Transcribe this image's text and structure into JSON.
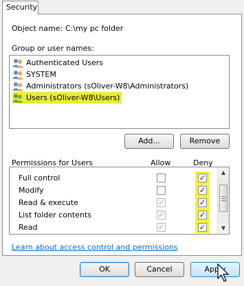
{
  "tab": {
    "label": "Security"
  },
  "object": {
    "label": "Object name:",
    "value": "C:\\my pc folder"
  },
  "groups": {
    "label": "Group or user names:",
    "items": [
      {
        "label": "Authenticated Users",
        "selected": false
      },
      {
        "label": "SYSTEM",
        "selected": false
      },
      {
        "label": "Administrators (sOliver-W8\\Administrators)",
        "selected": false
      },
      {
        "label": "Users (sOliver-W8\\Users)",
        "selected": true
      }
    ]
  },
  "buttons": {
    "add": "Add...",
    "remove": "Remove"
  },
  "permissions": {
    "title": "Permissions for Users",
    "allow_header": "Allow",
    "deny_header": "Deny",
    "rows": [
      {
        "name": "Full control",
        "allow": false,
        "allow_disabled": false,
        "deny": true,
        "deny_highlight": true
      },
      {
        "name": "Modify",
        "allow": false,
        "allow_disabled": false,
        "deny": true,
        "deny_highlight": true
      },
      {
        "name": "Read & execute",
        "allow": true,
        "allow_disabled": true,
        "deny": true,
        "deny_highlight": true
      },
      {
        "name": "List folder contents",
        "allow": true,
        "allow_disabled": true,
        "deny": true,
        "deny_highlight": true
      },
      {
        "name": "Read",
        "allow": true,
        "allow_disabled": true,
        "deny": true,
        "deny_highlight": true
      }
    ]
  },
  "help_link": "Learn about access control and permissions",
  "footer": {
    "ok": "OK",
    "cancel": "Cancel",
    "apply": "Apply"
  },
  "icons": {
    "user": "users-group-icon",
    "checkmark": "✓"
  },
  "colors": {
    "highlight": "#f4f42e",
    "link": "#0066cc",
    "selection": "#e8ec3c"
  }
}
